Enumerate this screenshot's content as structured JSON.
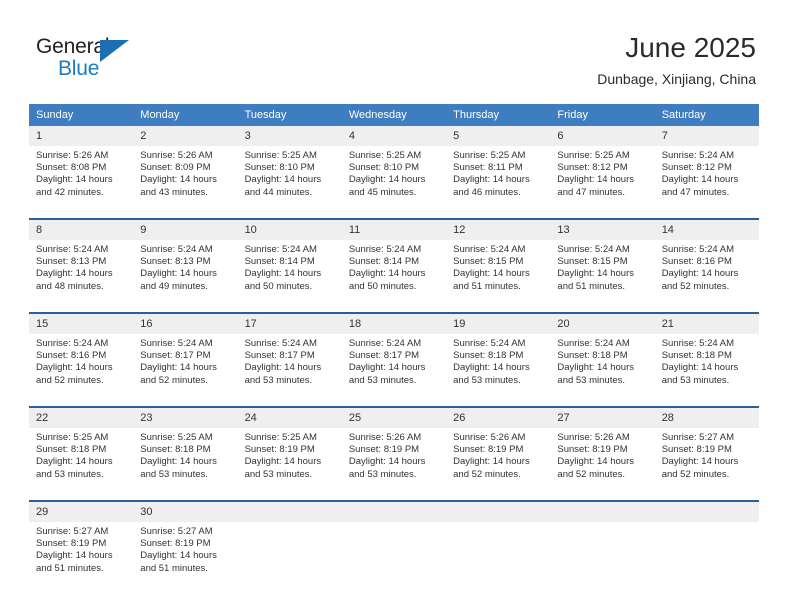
{
  "brand": {
    "name_part1": "General",
    "name_part2": "Blue",
    "accent_color": "#1d7cc4",
    "triangle_icon": "brand-triangle-icon"
  },
  "header": {
    "month_title": "June 2025",
    "location": "Dunbage, Xinjiang, China",
    "header_bg_color": "#3d7dc0",
    "week_divider_color": "#2a6099",
    "daynum_bg_color": "#efefef"
  },
  "weekday_headers": [
    "Sunday",
    "Monday",
    "Tuesday",
    "Wednesday",
    "Thursday",
    "Friday",
    "Saturday"
  ],
  "weeks": [
    {
      "days": [
        {
          "num": "1",
          "sunrise": "Sunrise: 5:26 AM",
          "sunset": "Sunset: 8:08 PM",
          "daylight_1": "Daylight: 14 hours",
          "daylight_2": "and 42 minutes."
        },
        {
          "num": "2",
          "sunrise": "Sunrise: 5:26 AM",
          "sunset": "Sunset: 8:09 PM",
          "daylight_1": "Daylight: 14 hours",
          "daylight_2": "and 43 minutes."
        },
        {
          "num": "3",
          "sunrise": "Sunrise: 5:25 AM",
          "sunset": "Sunset: 8:10 PM",
          "daylight_1": "Daylight: 14 hours",
          "daylight_2": "and 44 minutes."
        },
        {
          "num": "4",
          "sunrise": "Sunrise: 5:25 AM",
          "sunset": "Sunset: 8:10 PM",
          "daylight_1": "Daylight: 14 hours",
          "daylight_2": "and 45 minutes."
        },
        {
          "num": "5",
          "sunrise": "Sunrise: 5:25 AM",
          "sunset": "Sunset: 8:11 PM",
          "daylight_1": "Daylight: 14 hours",
          "daylight_2": "and 46 minutes."
        },
        {
          "num": "6",
          "sunrise": "Sunrise: 5:25 AM",
          "sunset": "Sunset: 8:12 PM",
          "daylight_1": "Daylight: 14 hours",
          "daylight_2": "and 47 minutes."
        },
        {
          "num": "7",
          "sunrise": "Sunrise: 5:24 AM",
          "sunset": "Sunset: 8:12 PM",
          "daylight_1": "Daylight: 14 hours",
          "daylight_2": "and 47 minutes."
        }
      ]
    },
    {
      "days": [
        {
          "num": "8",
          "sunrise": "Sunrise: 5:24 AM",
          "sunset": "Sunset: 8:13 PM",
          "daylight_1": "Daylight: 14 hours",
          "daylight_2": "and 48 minutes."
        },
        {
          "num": "9",
          "sunrise": "Sunrise: 5:24 AM",
          "sunset": "Sunset: 8:13 PM",
          "daylight_1": "Daylight: 14 hours",
          "daylight_2": "and 49 minutes."
        },
        {
          "num": "10",
          "sunrise": "Sunrise: 5:24 AM",
          "sunset": "Sunset: 8:14 PM",
          "daylight_1": "Daylight: 14 hours",
          "daylight_2": "and 50 minutes."
        },
        {
          "num": "11",
          "sunrise": "Sunrise: 5:24 AM",
          "sunset": "Sunset: 8:14 PM",
          "daylight_1": "Daylight: 14 hours",
          "daylight_2": "and 50 minutes."
        },
        {
          "num": "12",
          "sunrise": "Sunrise: 5:24 AM",
          "sunset": "Sunset: 8:15 PM",
          "daylight_1": "Daylight: 14 hours",
          "daylight_2": "and 51 minutes."
        },
        {
          "num": "13",
          "sunrise": "Sunrise: 5:24 AM",
          "sunset": "Sunset: 8:15 PM",
          "daylight_1": "Daylight: 14 hours",
          "daylight_2": "and 51 minutes."
        },
        {
          "num": "14",
          "sunrise": "Sunrise: 5:24 AM",
          "sunset": "Sunset: 8:16 PM",
          "daylight_1": "Daylight: 14 hours",
          "daylight_2": "and 52 minutes."
        }
      ]
    },
    {
      "days": [
        {
          "num": "15",
          "sunrise": "Sunrise: 5:24 AM",
          "sunset": "Sunset: 8:16 PM",
          "daylight_1": "Daylight: 14 hours",
          "daylight_2": "and 52 minutes."
        },
        {
          "num": "16",
          "sunrise": "Sunrise: 5:24 AM",
          "sunset": "Sunset: 8:17 PM",
          "daylight_1": "Daylight: 14 hours",
          "daylight_2": "and 52 minutes."
        },
        {
          "num": "17",
          "sunrise": "Sunrise: 5:24 AM",
          "sunset": "Sunset: 8:17 PM",
          "daylight_1": "Daylight: 14 hours",
          "daylight_2": "and 53 minutes."
        },
        {
          "num": "18",
          "sunrise": "Sunrise: 5:24 AM",
          "sunset": "Sunset: 8:17 PM",
          "daylight_1": "Daylight: 14 hours",
          "daylight_2": "and 53 minutes."
        },
        {
          "num": "19",
          "sunrise": "Sunrise: 5:24 AM",
          "sunset": "Sunset: 8:18 PM",
          "daylight_1": "Daylight: 14 hours",
          "daylight_2": "and 53 minutes."
        },
        {
          "num": "20",
          "sunrise": "Sunrise: 5:24 AM",
          "sunset": "Sunset: 8:18 PM",
          "daylight_1": "Daylight: 14 hours",
          "daylight_2": "and 53 minutes."
        },
        {
          "num": "21",
          "sunrise": "Sunrise: 5:24 AM",
          "sunset": "Sunset: 8:18 PM",
          "daylight_1": "Daylight: 14 hours",
          "daylight_2": "and 53 minutes."
        }
      ]
    },
    {
      "days": [
        {
          "num": "22",
          "sunrise": "Sunrise: 5:25 AM",
          "sunset": "Sunset: 8:18 PM",
          "daylight_1": "Daylight: 14 hours",
          "daylight_2": "and 53 minutes."
        },
        {
          "num": "23",
          "sunrise": "Sunrise: 5:25 AM",
          "sunset": "Sunset: 8:18 PM",
          "daylight_1": "Daylight: 14 hours",
          "daylight_2": "and 53 minutes."
        },
        {
          "num": "24",
          "sunrise": "Sunrise: 5:25 AM",
          "sunset": "Sunset: 8:19 PM",
          "daylight_1": "Daylight: 14 hours",
          "daylight_2": "and 53 minutes."
        },
        {
          "num": "25",
          "sunrise": "Sunrise: 5:26 AM",
          "sunset": "Sunset: 8:19 PM",
          "daylight_1": "Daylight: 14 hours",
          "daylight_2": "and 53 minutes."
        },
        {
          "num": "26",
          "sunrise": "Sunrise: 5:26 AM",
          "sunset": "Sunset: 8:19 PM",
          "daylight_1": "Daylight: 14 hours",
          "daylight_2": "and 52 minutes."
        },
        {
          "num": "27",
          "sunrise": "Sunrise: 5:26 AM",
          "sunset": "Sunset: 8:19 PM",
          "daylight_1": "Daylight: 14 hours",
          "daylight_2": "and 52 minutes."
        },
        {
          "num": "28",
          "sunrise": "Sunrise: 5:27 AM",
          "sunset": "Sunset: 8:19 PM",
          "daylight_1": "Daylight: 14 hours",
          "daylight_2": "and 52 minutes."
        }
      ]
    },
    {
      "days": [
        {
          "num": "29",
          "sunrise": "Sunrise: 5:27 AM",
          "sunset": "Sunset: 8:19 PM",
          "daylight_1": "Daylight: 14 hours",
          "daylight_2": "and 51 minutes."
        },
        {
          "num": "30",
          "sunrise": "Sunrise: 5:27 AM",
          "sunset": "Sunset: 8:19 PM",
          "daylight_1": "Daylight: 14 hours",
          "daylight_2": "and 51 minutes."
        },
        {
          "num": "",
          "sunrise": "",
          "sunset": "",
          "daylight_1": "",
          "daylight_2": ""
        },
        {
          "num": "",
          "sunrise": "",
          "sunset": "",
          "daylight_1": "",
          "daylight_2": ""
        },
        {
          "num": "",
          "sunrise": "",
          "sunset": "",
          "daylight_1": "",
          "daylight_2": ""
        },
        {
          "num": "",
          "sunrise": "",
          "sunset": "",
          "daylight_1": "",
          "daylight_2": ""
        },
        {
          "num": "",
          "sunrise": "",
          "sunset": "",
          "daylight_1": "",
          "daylight_2": ""
        }
      ]
    }
  ]
}
